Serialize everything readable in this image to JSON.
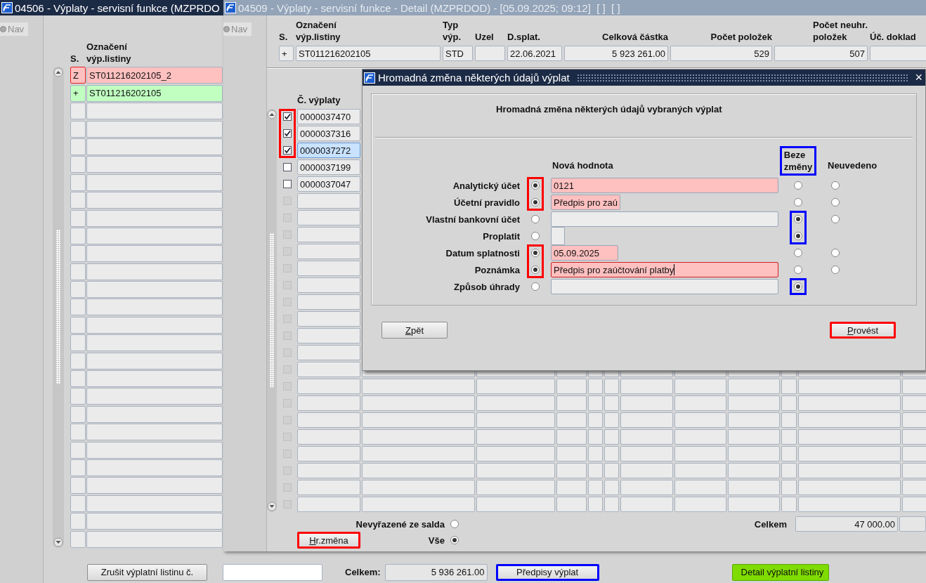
{
  "window_back": {
    "title": "04506 - Výplaty - servisní funkce (MZPRDO",
    "active": true,
    "nav": {
      "label": "Nav"
    },
    "list": {
      "columns": [
        "S.",
        "Označení\nvýp.listiny"
      ],
      "rows": [
        {
          "kind": "record",
          "status": "Z",
          "name": "ST011216202105_2",
          "color": "#ffc0c0",
          "current": true
        },
        {
          "kind": "record",
          "status": "+",
          "name": "ST011216202105",
          "color": "#c0ffc0",
          "current": false
        },
        {
          "kind": "empty"
        },
        {
          "kind": "empty"
        },
        {
          "kind": "empty"
        },
        {
          "kind": "empty"
        },
        {
          "kind": "empty"
        },
        {
          "kind": "empty"
        },
        {
          "kind": "empty"
        },
        {
          "kind": "empty"
        },
        {
          "kind": "empty"
        },
        {
          "kind": "empty"
        },
        {
          "kind": "empty"
        },
        {
          "kind": "empty"
        },
        {
          "kind": "empty"
        },
        {
          "kind": "empty"
        },
        {
          "kind": "empty"
        },
        {
          "kind": "empty"
        },
        {
          "kind": "empty"
        },
        {
          "kind": "empty"
        },
        {
          "kind": "empty"
        },
        {
          "kind": "empty"
        },
        {
          "kind": "empty"
        },
        {
          "kind": "empty"
        },
        {
          "kind": "empty"
        },
        {
          "kind": "empty"
        },
        {
          "kind": "empty"
        }
      ]
    },
    "footer": {
      "cancel_button": {
        "label": "Zrušit výplatní listinu č."
      },
      "total_label": "Celkem:",
      "total_value": "5 936 261.00",
      "buttons": [
        {
          "label": "Předpisy výplat",
          "kind": "plain",
          "color": "#0000ff"
        },
        {
          "label": "Detail výplatní listiny",
          "kind": "accent"
        }
      ]
    }
  },
  "window_front": {
    "title": "04509 - Výplaty - servisní funkce - Detail (MZPRDOD) - [05.09.2025; 09:12]  [ ]  [ ]",
    "active": false,
    "nav": {
      "label": "Nav"
    },
    "header": [
      {
        "label": "S.",
        "value": "+",
        "kind": "text"
      },
      {
        "label": "Označení\nvýp.listiny",
        "value": "ST011216202105",
        "kind": "text"
      },
      {
        "label": "Typ\nvýp.",
        "value": "STD",
        "kind": "text"
      },
      {
        "label": "Uzel",
        "kind": "text"
      },
      {
        "label": "D.splat.",
        "value": "22.06.2021",
        "kind": "text"
      },
      {
        "label": "Celková částka",
        "value": "5 923 261.00",
        "kind": "number"
      },
      {
        "label": "Počet položek",
        "value": "529",
        "kind": "number"
      },
      {
        "label": "Počet neuhr.\npoložek",
        "value": "507",
        "kind": "number"
      },
      {
        "label": "Úč. doklad",
        "kind": "text"
      }
    ],
    "payments": {
      "column": "Č. výplaty",
      "rows": [
        {
          "kind": "record",
          "checked": true,
          "number": "0000037470",
          "selected": false,
          "color": "#ff0000"
        },
        {
          "kind": "record",
          "checked": true,
          "number": "0000037316",
          "selected": false,
          "color": "#ff0000"
        },
        {
          "kind": "record",
          "checked": true,
          "number": "0000037272",
          "selected": true,
          "color": "#ff0000"
        },
        {
          "kind": "record",
          "checked": false,
          "number": "0000037199",
          "selected": false
        },
        {
          "kind": "record",
          "checked": false,
          "number": "0000037047",
          "selected": false
        },
        {
          "kind": "empty",
          "checked": false
        },
        {
          "kind": "empty",
          "checked": false
        },
        {
          "kind": "empty",
          "checked": false
        },
        {
          "kind": "empty",
          "checked": false
        },
        {
          "kind": "empty",
          "checked": false
        },
        {
          "kind": "empty",
          "checked": false
        },
        {
          "kind": "empty",
          "checked": false
        },
        {
          "kind": "empty",
          "checked": false
        },
        {
          "kind": "empty",
          "checked": false
        },
        {
          "kind": "empty",
          "checked": false
        },
        {
          "kind": "empty",
          "checked": false
        },
        {
          "kind": "empty",
          "checked": false
        },
        {
          "kind": "empty",
          "checked": false
        },
        {
          "kind": "empty",
          "checked": false
        },
        {
          "kind": "empty",
          "checked": false
        },
        {
          "kind": "empty",
          "checked": false
        },
        {
          "kind": "empty",
          "checked": false
        },
        {
          "kind": "empty",
          "checked": false
        },
        {
          "kind": "empty",
          "checked": false
        }
      ]
    },
    "filter": [
      {
        "label": "Nevyřazené ze salda",
        "selected": false
      },
      {
        "label": "Vše",
        "selected": true
      }
    ],
    "bulk_button": {
      "label": "Hr.změna",
      "mnemonic": true,
      "color": "#ff0000"
    },
    "total": {
      "label": "Celkem",
      "value": "47 000.00"
    }
  },
  "dialog": {
    "title": "Hromadná změna některých údajů výplat",
    "close_label": "×",
    "heading": "Hromadná změna některých údajů vybraných výplat",
    "columns": [
      {
        "label": "Nová hodnota"
      },
      {
        "label": "Beze\nzměny",
        "color": "#0000ff"
      },
      {
        "label": "Neuvedeno"
      }
    ],
    "rows": [
      {
        "label": "Analytický účet",
        "kind": "long",
        "value": "0121",
        "changed": true,
        "options": [
          {
            "selected": true,
            "color": "#ff0000"
          },
          {
            "selected": false
          },
          {
            "selected": false
          }
        ]
      },
      {
        "label": "Účetní pravidlo",
        "kind": "short",
        "value": "Předpis pro zaú",
        "changed": true,
        "options": [
          {
            "selected": true,
            "color": "#ff0000"
          },
          {
            "selected": false
          },
          {
            "selected": false
          }
        ]
      },
      {
        "label": "Vlastní bankovní účet",
        "kind": "long",
        "changed": false,
        "options": [
          {
            "selected": false
          },
          {
            "selected": true,
            "color": "#0000ff"
          },
          {
            "selected": false
          }
        ]
      },
      {
        "label": "Proplatit",
        "kind": "checkbox",
        "changed": false,
        "options": [
          {
            "selected": false
          },
          {
            "selected": true,
            "color": "#0000ff"
          }
        ]
      },
      {
        "label": "Datum splatnosti",
        "kind": "short",
        "value": "05.09.2025",
        "changed": true,
        "options": [
          {
            "selected": true,
            "color": "#ff0000"
          },
          {
            "selected": false
          },
          {
            "selected": false
          }
        ]
      },
      {
        "label": "Poznámka",
        "kind": "long",
        "value": "Předpis pro zaúčtování platby",
        "changed": true,
        "focused": true,
        "options": [
          {
            "selected": true,
            "color": "#ff0000"
          },
          {
            "selected": false
          },
          {
            "selected": false
          }
        ]
      },
      {
        "label": "Způsob úhrady",
        "kind": "long",
        "changed": false,
        "options": [
          {
            "selected": false
          },
          {
            "selected": true,
            "color": "#0000ff"
          }
        ]
      }
    ],
    "buttons": [
      {
        "label": "Zpět",
        "mnemonic": true
      },
      {
        "label": "Provést",
        "mnemonic": true,
        "color": "#ff0000"
      }
    ]
  }
}
